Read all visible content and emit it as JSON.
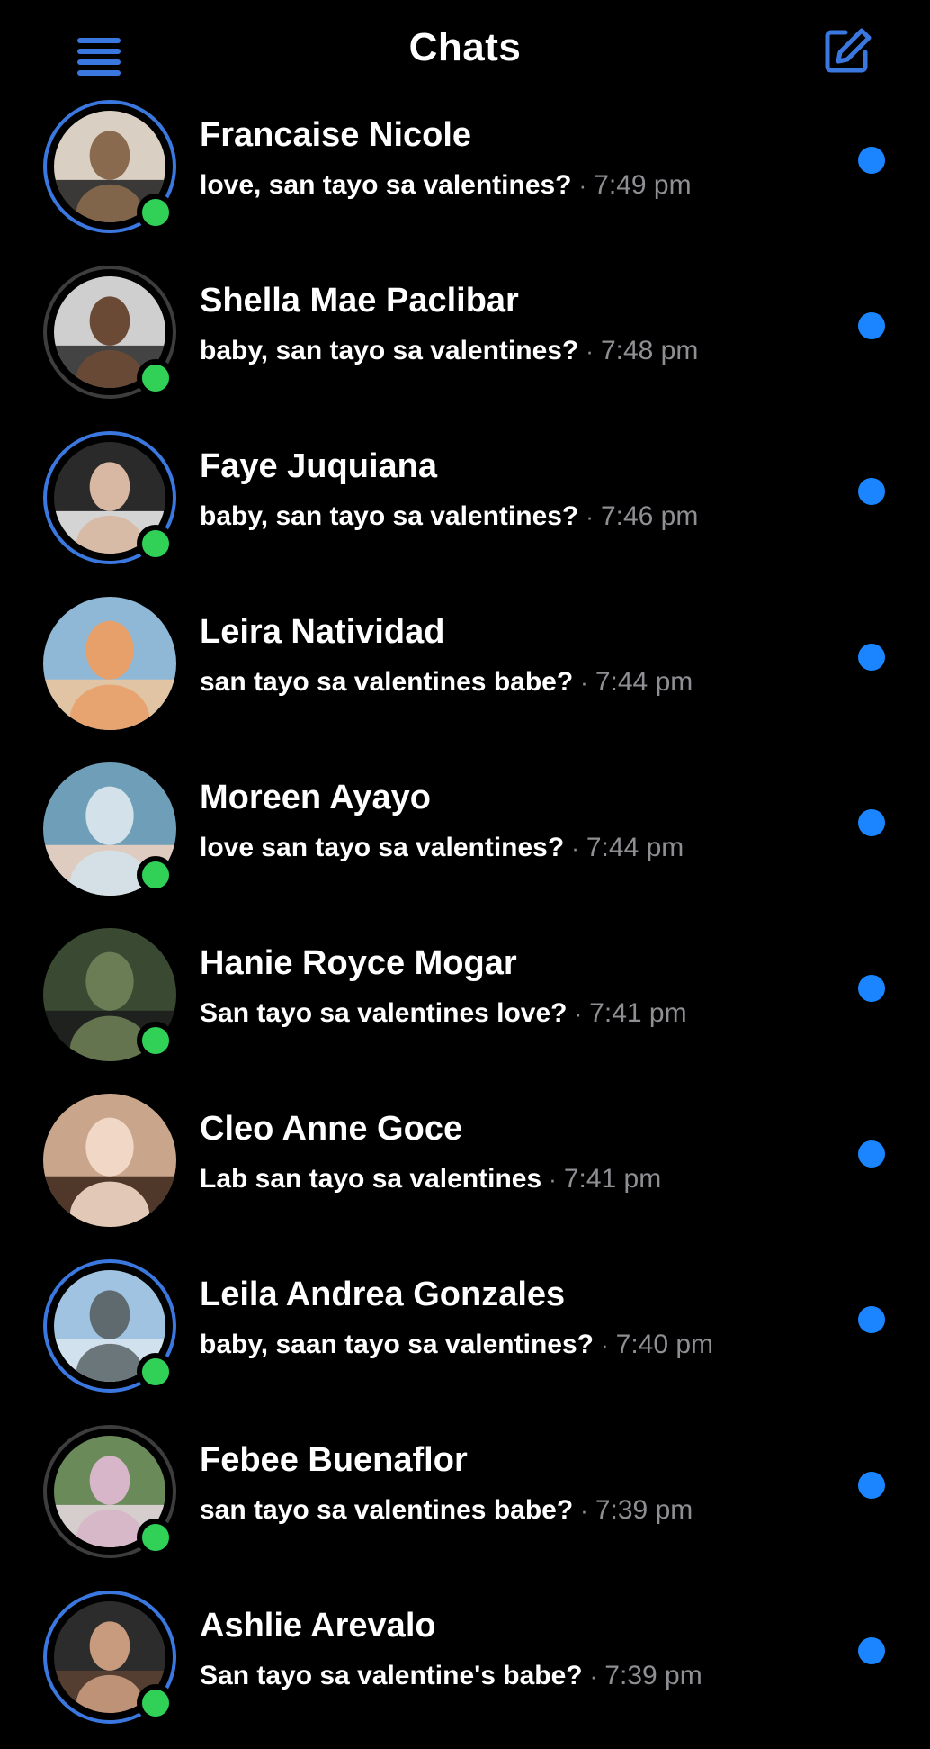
{
  "header": {
    "title": "Chats",
    "menu_icon": "hamburger-menu-icon",
    "compose_icon": "compose-icon",
    "accent": "#3a78e0"
  },
  "colors": {
    "background": "#000000",
    "story_ring_unseen": "#3a78e0",
    "story_ring_seen": "#3d3d3d",
    "online": "#31d158",
    "unread_dot": "#1a85ff",
    "secondary_text": "#8e8e93"
  },
  "chats": [
    {
      "name": "Francaise Nicole",
      "message": "love, san tayo sa valentines?",
      "separator": "·",
      "time": "7:49 pm",
      "ring": "story-blue",
      "online": true,
      "unread": true
    },
    {
      "name": "Shella Mae Paclibar",
      "message": "baby, san tayo sa valentines?",
      "separator": "·",
      "time": "7:48 pm",
      "ring": "story-gray",
      "online": true,
      "unread": true
    },
    {
      "name": "Faye Juquiana",
      "message": "baby, san tayo sa valentines?",
      "separator": "·",
      "time": "7:46 pm",
      "ring": "story-blue",
      "online": true,
      "unread": true
    },
    {
      "name": "Leira Natividad",
      "message": "san tayo sa valentines babe?",
      "separator": "·",
      "time": "7:44 pm",
      "ring": "none",
      "online": false,
      "unread": true
    },
    {
      "name": "Moreen Ayayo",
      "message": "love san tayo sa valentines?",
      "separator": "·",
      "time": "7:44 pm",
      "ring": "none",
      "online": true,
      "unread": true
    },
    {
      "name": "Hanie Royce Mogar",
      "message": "San tayo sa valentines love?",
      "separator": "·",
      "time": "7:41 pm",
      "ring": "none",
      "online": true,
      "unread": true
    },
    {
      "name": "Cleo Anne Goce",
      "message": "Lab san tayo sa valentines",
      "separator": "·",
      "time": "7:41 pm",
      "ring": "none",
      "online": false,
      "unread": true
    },
    {
      "name": "Leila Andrea Gonzales",
      "message": "baby, saan tayo sa valentines?",
      "separator": "·",
      "time": "7:40 pm",
      "ring": "story-blue",
      "online": true,
      "unread": true
    },
    {
      "name": "Febee Buenaflor",
      "message": "san tayo sa valentines babe?",
      "separator": "·",
      "time": "7:39 pm",
      "ring": "story-gray",
      "online": true,
      "unread": true
    },
    {
      "name": "Ashlie Arevalo",
      "message": "San tayo sa valentine's babe?",
      "separator": "·",
      "time": "7:39 pm",
      "ring": "story-blue",
      "online": true,
      "unread": true
    }
  ]
}
